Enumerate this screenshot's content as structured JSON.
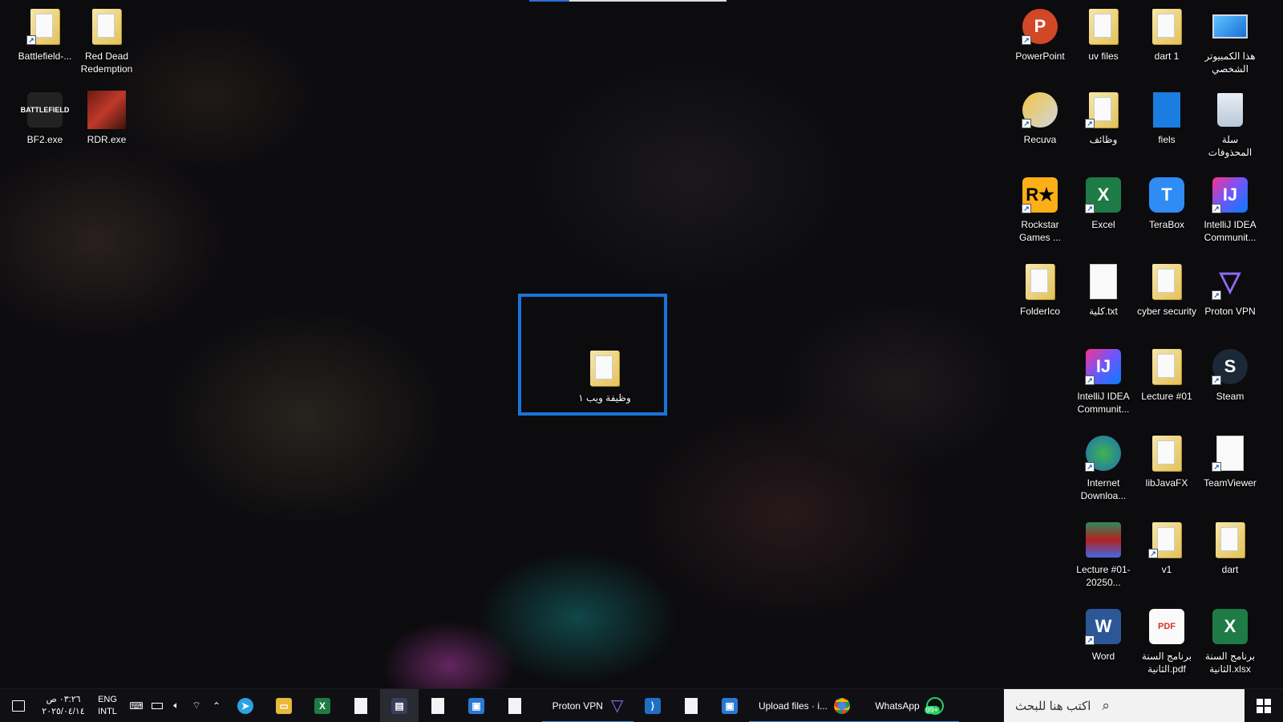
{
  "desktop": {
    "icons": [
      {
        "label": "Battlefield-...",
        "icon": "folder-shortcut-icon"
      },
      {
        "label": "Red Dead Redemption",
        "icon": "folder-icon"
      },
      {
        "label": "BF2.exe",
        "icon": "battlefield-icon",
        "badge": "BATTLEFIELD"
      },
      {
        "label": "RDR.exe",
        "icon": "rdr-icon"
      },
      {
        "label": "PowerPoint",
        "icon": "powerpoint-icon",
        "badge": "P"
      },
      {
        "label": "uv files",
        "icon": "pdf-folder-icon"
      },
      {
        "label": "dart 1",
        "icon": "folder-icon"
      },
      {
        "label": "هذا الكمبيوتر الشخصي",
        "icon": "this-pc-icon"
      },
      {
        "label": "Recuva",
        "icon": "recuva-icon"
      },
      {
        "label": "وظائف",
        "icon": "edge-folder-icon"
      },
      {
        "label": "fiels",
        "icon": "blue-file-icon"
      },
      {
        "label": "سلة المحذوفات",
        "icon": "recycle-bin-icon"
      },
      {
        "label": "Rockstar Games ...",
        "icon": "rockstar-icon",
        "badge": "R★"
      },
      {
        "label": "Excel",
        "icon": "excel-icon",
        "badge": "X"
      },
      {
        "label": "TeraBox",
        "icon": "terabox-icon",
        "badge": "T"
      },
      {
        "label": "IntelliJ IDEA Communit...",
        "icon": "intellij-icon",
        "badge": "IJ"
      },
      {
        "label": "FolderIco",
        "icon": "folder-icon"
      },
      {
        "label": "كلية.txt",
        "icon": "text-file-icon"
      },
      {
        "label": "cyber security",
        "icon": "folder-icon"
      },
      {
        "label": "Proton VPN",
        "icon": "proton-vpn-icon",
        "badge": "▽"
      },
      {
        "label": "IntelliJ IDEA Communit...",
        "icon": "intellij-icon",
        "badge": "IJ"
      },
      {
        "label": "Lecture #01",
        "icon": "folder-icon"
      },
      {
        "label": "Steam",
        "icon": "steam-icon",
        "badge": "S"
      },
      {
        "label": "Internet Downloa...",
        "icon": "idm-icon"
      },
      {
        "label": "libJavaFX",
        "icon": "folder-icon"
      },
      {
        "label": "TeamViewer",
        "icon": "file-shortcut-icon"
      },
      {
        "label": "Lecture #01-20250...",
        "icon": "winrar-icon"
      },
      {
        "label": "v1",
        "icon": "edge-folder-icon"
      },
      {
        "label": "dart",
        "icon": "folder-icon"
      },
      {
        "label": "Word",
        "icon": "word-icon",
        "badge": "W"
      },
      {
        "label": "برنامج السنة الثانية.pdf",
        "icon": "pdf-file-icon",
        "badge": "PDF"
      },
      {
        "label": "برنامج السنة الثانية.xlsx",
        "icon": "excel-file-icon",
        "badge": "X"
      }
    ],
    "selected": {
      "label": "وظيفة ويب ١",
      "icon": "folder-icon"
    }
  },
  "taskbar": {
    "action_center": "notification-icon",
    "clock": {
      "time": "٠٣:٢٦ ص",
      "date": "٢٠٢٥/٠٤/١٤"
    },
    "language": {
      "lang": "ENG",
      "layout": "INTL"
    },
    "tray": [
      "keyboard-icon",
      "battery-icon",
      "volume-icon",
      "wifi-icon",
      "chevron-up-icon"
    ],
    "pinned": [
      {
        "name": "telegram-icon",
        "color": "#2aa3e0",
        "glyph": "➤"
      },
      {
        "name": "file-explorer-icon",
        "color": "#e8b93a",
        "glyph": "▭"
      },
      {
        "name": "excel-taskbar-icon",
        "color": "#1e7b45",
        "glyph": "X"
      },
      {
        "name": "blank-file-icon",
        "color": "#f4f4f4",
        "glyph": ""
      },
      {
        "name": "monitor-app-icon",
        "color": "#3a3f5c",
        "glyph": "▤"
      },
      {
        "name": "blank-file-icon",
        "color": "#f4f4f4",
        "glyph": ""
      },
      {
        "name": "window-app-icon",
        "color": "#2b78d4",
        "glyph": "▣"
      },
      {
        "name": "blank-file-icon",
        "color": "#f4f4f4",
        "glyph": ""
      }
    ],
    "proton_vpn": {
      "label": "Proton VPN"
    },
    "vscode": {
      "name": "vscode-icon"
    },
    "more_pinned": [
      {
        "name": "blank-file-icon",
        "color": "#f4f4f4",
        "glyph": ""
      },
      {
        "name": "window-app-icon",
        "color": "#2b78d4",
        "glyph": "▣"
      }
    ],
    "chrome_task": {
      "label": "Upload files · i..."
    },
    "whatsapp": {
      "label": "WhatsApp",
      "badge": "99+"
    },
    "search": {
      "placeholder": "اكتب هنا للبحث"
    }
  }
}
